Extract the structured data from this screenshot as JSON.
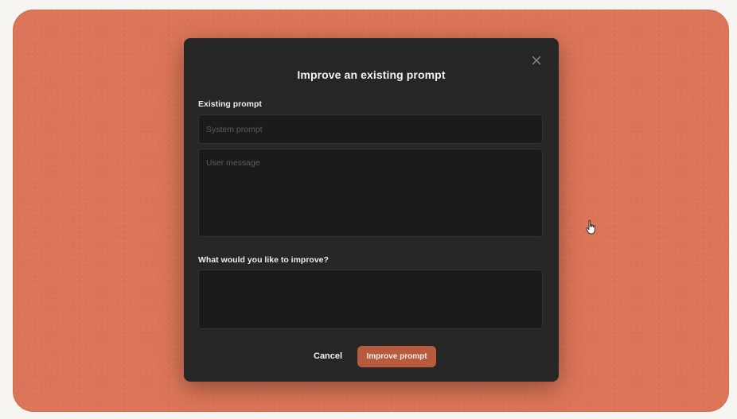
{
  "modal": {
    "title": "Improve an existing prompt",
    "close_icon": "close-icon",
    "existing_prompt_label": "Existing prompt",
    "system_prompt": {
      "placeholder": "System prompt",
      "value": ""
    },
    "user_message": {
      "placeholder": "User message",
      "value": ""
    },
    "improve_label": "What would you like to improve?",
    "improve_field": {
      "placeholder": "",
      "value": ""
    },
    "cancel_label": "Cancel",
    "submit_label": "Improve prompt"
  },
  "colors": {
    "background": "#dc7557",
    "modal": "#262626",
    "field": "#1b1b1b",
    "accent_button": "#b85a3d"
  },
  "cursor_icon": "hand-pointer-icon"
}
